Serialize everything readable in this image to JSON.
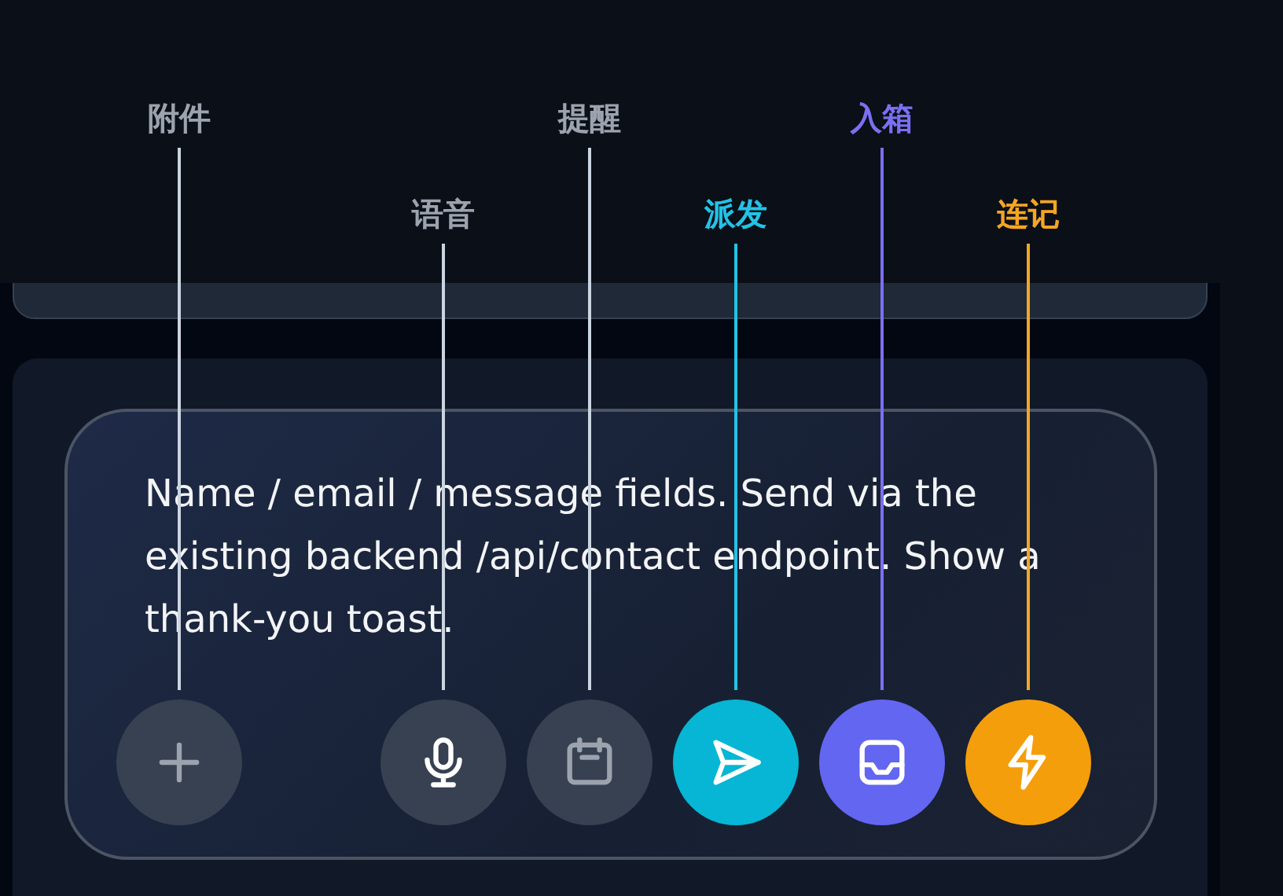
{
  "composer": {
    "text": "Name / email / message fields. Send via the existing backend /api/contact endpoint. Show a thank-you toast."
  },
  "actions": [
    {
      "kind": "attach",
      "color": "#374151",
      "callout": {
        "label": "附件",
        "color": "#9ca3af"
      }
    },
    {
      "kind": "voice",
      "color": "#374151",
      "callout": {
        "label": "语音",
        "color": "#9ca3af"
      }
    },
    {
      "kind": "remind",
      "color": "#374151",
      "callout": {
        "label": "提醒",
        "color": "#9ca3af"
      }
    },
    {
      "kind": "dispatch",
      "color": "#06b6d4",
      "callout": {
        "label": "派发",
        "color": "#22c3e6"
      }
    },
    {
      "kind": "inbox",
      "color": "#6366f1",
      "callout": {
        "label": "入箱",
        "color": "#7b6ff2"
      }
    },
    {
      "kind": "quick",
      "color": "#f59e0b",
      "callout": {
        "label": "连记",
        "color": "#f5a524"
      }
    }
  ]
}
